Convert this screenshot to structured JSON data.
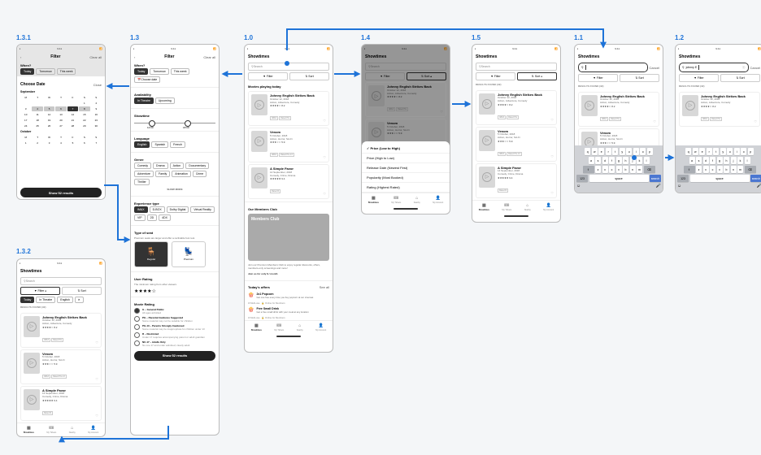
{
  "labels": {
    "s131": "1.3.1",
    "s13": "1.3",
    "s10": "1.0",
    "s14": "1.4",
    "s15": "1.5",
    "s11": "1.1",
    "s12": "1.2",
    "s132": "1.3.2"
  },
  "common": {
    "time": "9:41",
    "showtimes_title": "Showtimes",
    "search_placeholder": "Search",
    "filter": "Filter",
    "sort": "Sort",
    "clear_all": "Clear all",
    "cancel": "Cancel",
    "results_found": "RESULTS FOUND (32)",
    "movies_playing": "Movies playing today",
    "see_all": "See all",
    "tabs": {
      "showtimes": "Showtimes",
      "tickets": "My Tickets",
      "nearby": "Nearby",
      "account": "My Account"
    },
    "funnel": "▼",
    "sort_icon": "⇅",
    "search_icon": "○",
    "back": "‹"
  },
  "movies": [
    {
      "title": "Johnny English Strikes Back",
      "date": "October 12, 2018",
      "genre": "Action, Adventure, Comedy",
      "stars": "★★★★☆",
      "rating": "8.2",
      "tags": [
        "IMAX",
        "Rated PG"
      ]
    },
    {
      "title": "Venom",
      "date": "5 October, 2018",
      "genre": "Action, Horror, Sci-Fi",
      "stars": "★★★☆☆",
      "rating": "5.9",
      "tags": [
        "IMAX",
        "Rated PG-13"
      ]
    },
    {
      "title": "A Simple Favor",
      "date": "14 September, 2018",
      "genre": "Comedy, Crime, Drama",
      "stars": "★★★★★",
      "rating": "9.4",
      "tags": [
        "Rated R"
      ]
    }
  ],
  "filter_screen": {
    "title": "Filter",
    "when": {
      "h": "When?",
      "today": "Today",
      "tomorrow": "Tomorrow",
      "this_week": "This week",
      "choose": "Choose date",
      "cal_icon": "📅"
    },
    "availability": {
      "h": "Availability",
      "in_theatre": "In Theatre",
      "upcoming": "Upcoming"
    },
    "showtime": {
      "h": "Showtime",
      "from": "12:00",
      "to": "18:00"
    },
    "language": {
      "h": "Language",
      "opts": [
        "English",
        "Spanish",
        "French"
      ]
    },
    "genre": {
      "h": "Genre",
      "opts": [
        "Comedy",
        "Drama",
        "Action",
        "Documentary",
        "Adventure",
        "Family",
        "Animation",
        "Crime",
        "Thriller"
      ],
      "more": "SHOW MORE"
    },
    "exp": {
      "h": "Experience type",
      "opts": [
        "IMAX",
        "D-BOX",
        "Dolby Digital",
        "Virtual Reality",
        "VIP",
        "2D",
        "4DX"
      ]
    },
    "seat": {
      "h": "Type of seat",
      "note": "Premium seats are larger and offer a reclinable foot rest.",
      "reg": "Regular",
      "prem": "Premium"
    },
    "user_rating": {
      "h": "User Rating",
      "note": "The minimum rating from other viewers",
      "stars": "★★★★☆"
    },
    "movie_rating": {
      "h": "Movie Rating",
      "opts": [
        {
          "t": "G – General Public",
          "s": "All ages admitted"
        },
        {
          "t": "PG – Parental Guidance Suggested",
          "s": "Some material may not be suitable for children"
        },
        {
          "t": "PG-13 – Parents Strongly Cautioned",
          "s": "Some material may be inappropriate for children under 13"
        },
        {
          "t": "R – Restricted",
          "s": "Under 17 requires accompanying parent or adult guardian"
        },
        {
          "t": "NC-17 – Adults Only",
          "s": "No one 17 and under admitted; clearly adult"
        }
      ]
    },
    "cta": "Show 52 results"
  },
  "cal_sheet": {
    "title": "Choose Date",
    "close": "Close",
    "sep": "September",
    "oct": "October",
    "cta": "Show 52 results"
  },
  "showtimes_big": {
    "club": {
      "h": "Our Members Club",
      "title": "Members Club",
      "body": "Join our Premium Members Club to enjoy regular discounts, offers, members-only screenings and more!",
      "cta": "Join us for only $ / month"
    },
    "offers": {
      "h": "Today's offers",
      "items": [
        {
          "t": "2x1 Popcorn",
          "s": "Get one free every time you buy popcorn at our cinemas"
        },
        {
          "t": "Free Small Drink",
          "s": "Get a free small drink with your meal at any location"
        }
      ],
      "meta": [
        "Multi-use",
        "Online for Members"
      ]
    }
  },
  "sort_sheet": {
    "items": [
      "Price (Low to High)",
      "Price (High to Low)",
      "Release Date (Newest First)",
      "Popularity (Most Booked)",
      "Rating (Highest Rated)"
    ]
  },
  "search_screens": {
    "q11": "",
    "q12": "johnny E",
    "space": "space",
    "search_key": "search",
    "nums": "123"
  },
  "kb_rows": [
    [
      "q",
      "w",
      "e",
      "r",
      "t",
      "y",
      "u",
      "i",
      "o",
      "p"
    ],
    [
      "a",
      "s",
      "d",
      "f",
      "g",
      "h",
      "j",
      "k",
      "l"
    ],
    [
      "z",
      "x",
      "c",
      "v",
      "b",
      "n",
      "m"
    ]
  ]
}
